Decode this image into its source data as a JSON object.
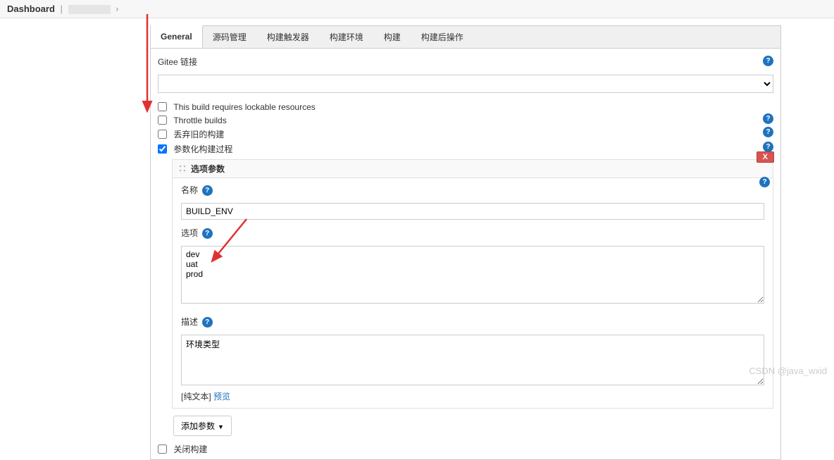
{
  "breadcrumb": {
    "dashboard": "Dashboard"
  },
  "tabs": [
    "General",
    "源码管理",
    "构建触发器",
    "构建环境",
    "构建",
    "构建后操作"
  ],
  "gitee": {
    "label": "Gitee 链接"
  },
  "checkboxes": {
    "lockable": "This build requires lockable resources",
    "throttle": "Throttle builds",
    "discard": "丢弃旧的构建",
    "parameterized": "参数化构建过程",
    "close": "关闭构建"
  },
  "param": {
    "header": "选项参数",
    "delete": "X",
    "name_label": "名称",
    "name_value": "BUILD_ENV",
    "options_label": "选项",
    "options_value": "dev\nuat\nprod",
    "desc_label": "描述",
    "desc_value": "环境类型",
    "plaintext_prefix": "[纯文本]",
    "preview": "预览"
  },
  "add_param": "添加参数",
  "watermark": "CSDN @java_wxid"
}
